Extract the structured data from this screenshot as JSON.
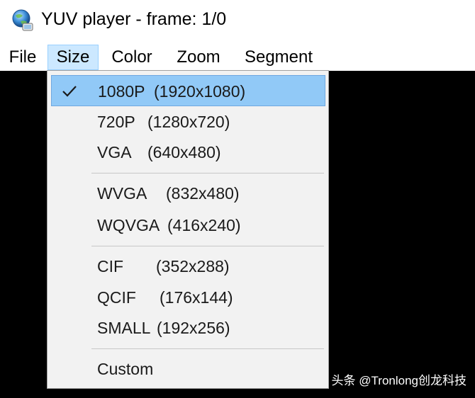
{
  "window": {
    "title": "YUV player - frame: 1/0",
    "icon": "globe-app-icon"
  },
  "menubar": {
    "items": [
      {
        "label": "File"
      },
      {
        "label": "Size",
        "active": true
      },
      {
        "label": "Color"
      },
      {
        "label": "Zoom"
      },
      {
        "label": "Segment"
      }
    ]
  },
  "size_menu": {
    "items": [
      {
        "name": "1080P",
        "res": "(1920x1080)",
        "checked": true
      },
      {
        "name": "720P",
        "res": "(1280x720)"
      },
      {
        "name": "VGA",
        "res": "(640x480)"
      },
      {
        "name": "WVGA",
        "res": "(832x480)"
      },
      {
        "name": "WQVGA",
        "res": "(416x240)"
      },
      {
        "name": "CIF",
        "res": "(352x288)"
      },
      {
        "name": "QCIF",
        "res": "(176x144)"
      },
      {
        "name": "SMALL",
        "res": "(192x256)"
      },
      {
        "name": "Custom",
        "res": ""
      }
    ]
  },
  "watermark": "头条 @Tronlong创龙科技",
  "colors": {
    "highlight": "#91c9f7",
    "menu_active": "#cce8ff",
    "menu_bg": "#f2f2f2",
    "video_area": "#000000"
  }
}
